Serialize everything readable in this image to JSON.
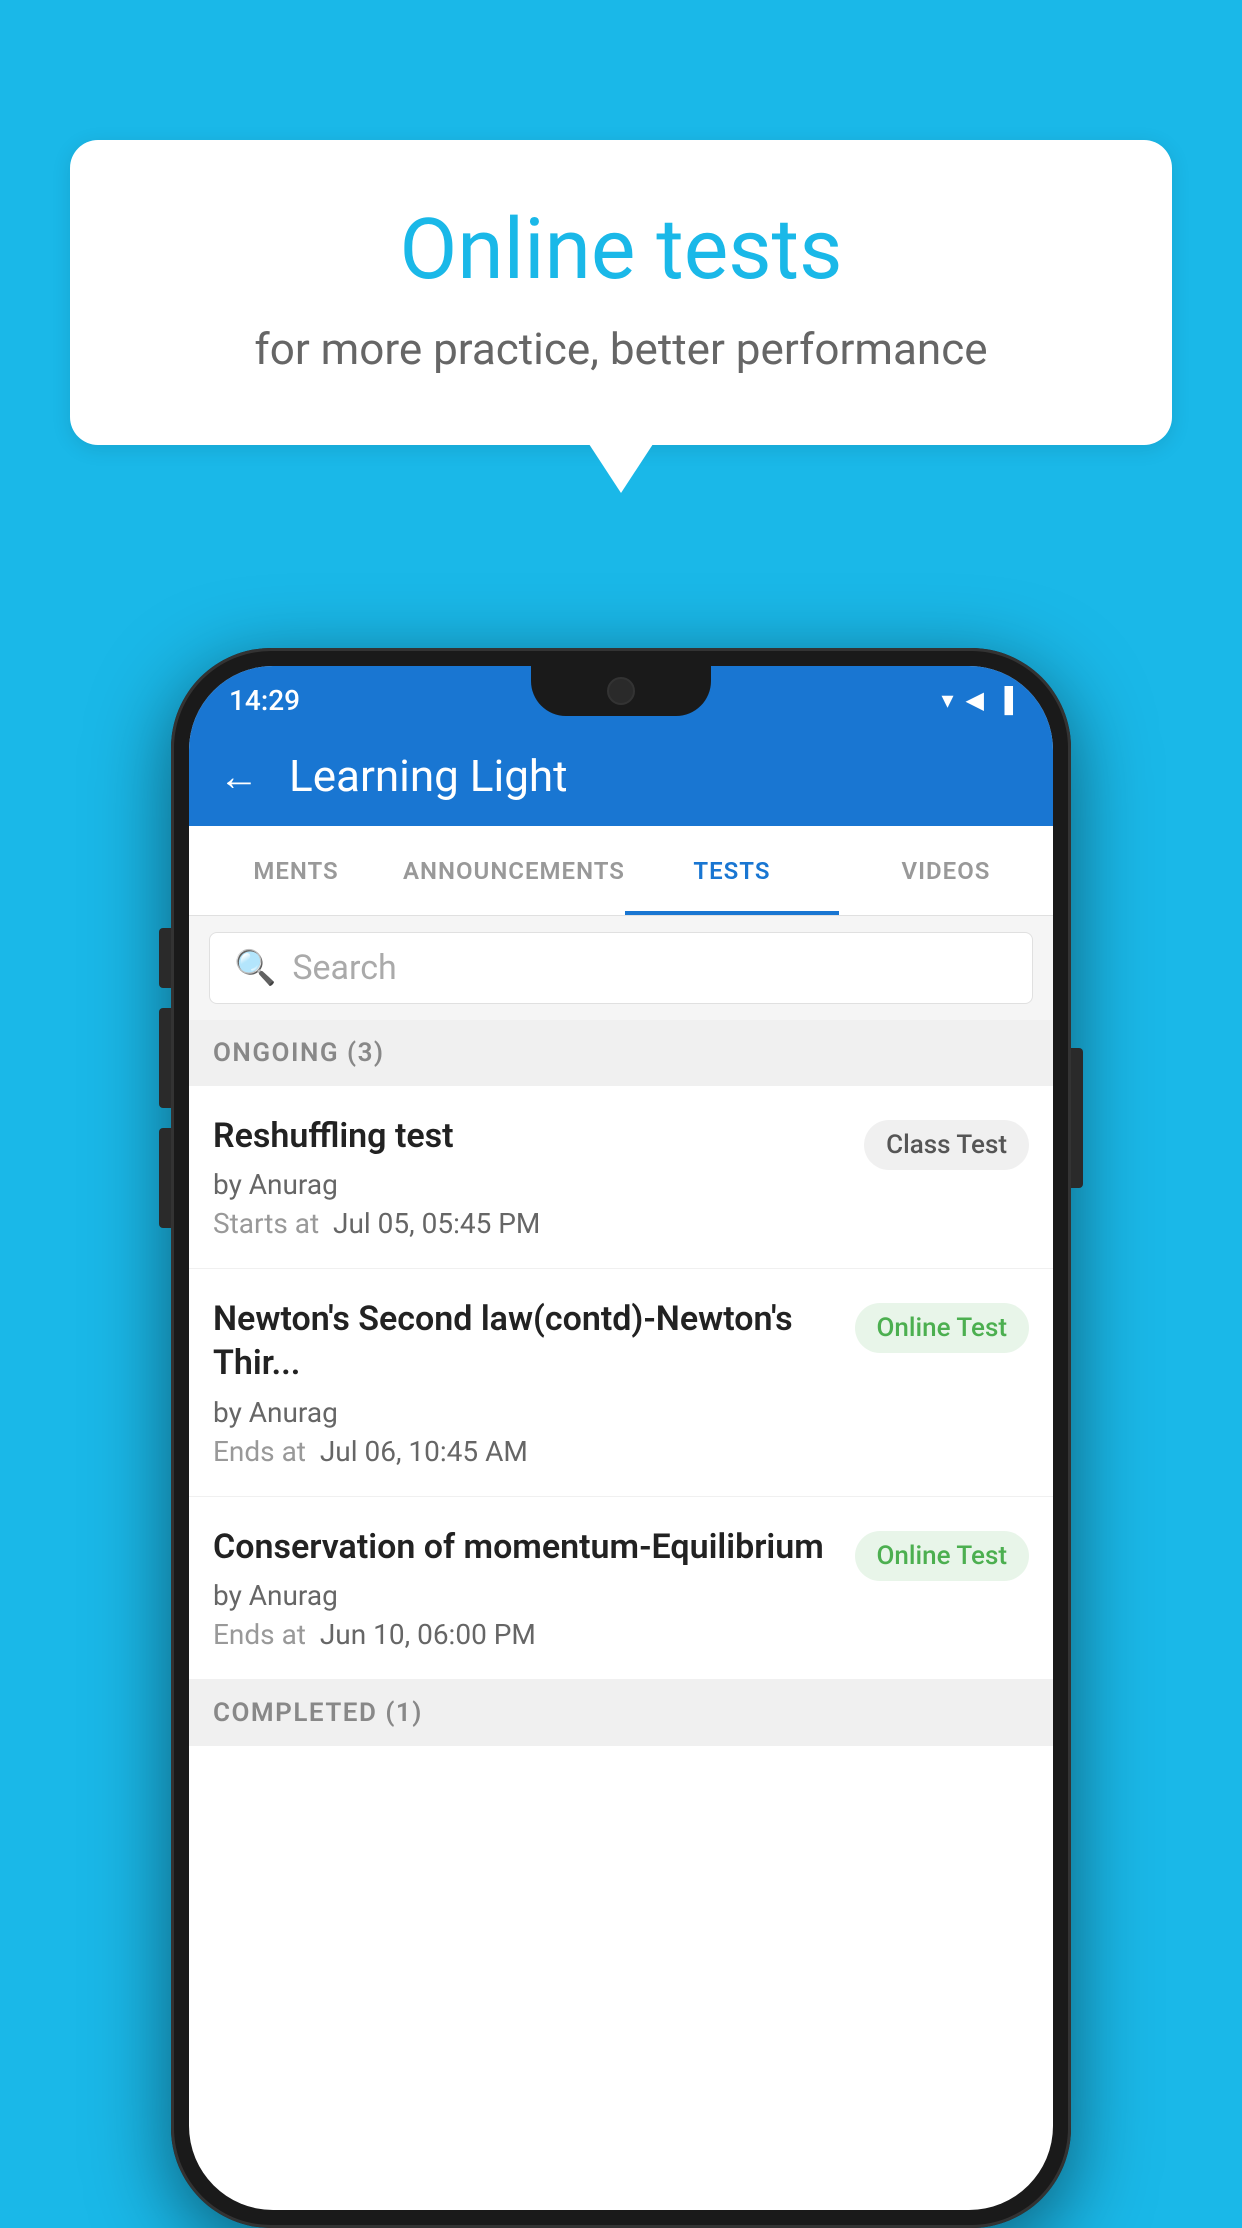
{
  "background": {
    "color": "#1ab8e8"
  },
  "speech_bubble": {
    "title": "Online tests",
    "subtitle": "for more practice, better performance"
  },
  "status_bar": {
    "time": "14:29",
    "icons": "▼◄▐"
  },
  "app_header": {
    "back_label": "←",
    "title": "Learning Light"
  },
  "tabs": [
    {
      "label": "MENTS",
      "active": false
    },
    {
      "label": "ANNOUNCEMENTS",
      "active": false
    },
    {
      "label": "TESTS",
      "active": true
    },
    {
      "label": "VIDEOS",
      "active": false
    }
  ],
  "search": {
    "placeholder": "Search"
  },
  "ongoing_section": {
    "label": "ONGOING (3)"
  },
  "tests": [
    {
      "name": "Reshuffling test",
      "author": "by Anurag",
      "date_label": "Starts at",
      "date": "Jul 05, 05:45 PM",
      "badge": "Class Test",
      "badge_type": "class"
    },
    {
      "name": "Newton's Second law(contd)-Newton's Thir...",
      "author": "by Anurag",
      "date_label": "Ends at",
      "date": "Jul 06, 10:45 AM",
      "badge": "Online Test",
      "badge_type": "online"
    },
    {
      "name": "Conservation of momentum-Equilibrium",
      "author": "by Anurag",
      "date_label": "Ends at",
      "date": "Jun 10, 06:00 PM",
      "badge": "Online Test",
      "badge_type": "online"
    }
  ],
  "completed_section": {
    "label": "COMPLETED (1)"
  }
}
